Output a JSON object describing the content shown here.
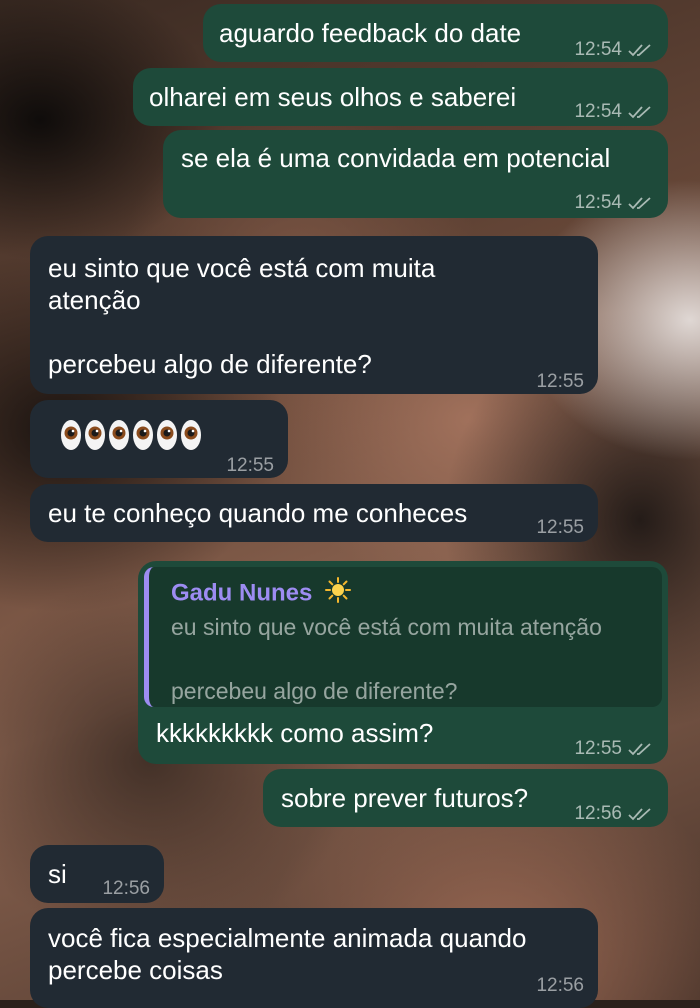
{
  "chat": {
    "messages": [
      {
        "direction": "out",
        "text": "aguardo feedback do date",
        "time": "12:54",
        "status": "read"
      },
      {
        "direction": "out",
        "text": "olharei em seus olhos e saberei",
        "time": "12:54",
        "status": "read"
      },
      {
        "direction": "out",
        "text": "se ela é uma convidada em potencial",
        "time": "12:54",
        "status": "read"
      },
      {
        "direction": "in",
        "text": "eu sinto que você está com muita\natenção\n\npercebeu algo de diferente?",
        "time": "12:55"
      },
      {
        "direction": "in",
        "emoji": "eyes",
        "emoji_count": 6,
        "time": "12:55"
      },
      {
        "direction": "in",
        "text": "eu te conheço quando me conheces",
        "time": "12:55"
      },
      {
        "direction": "out",
        "reply_to": {
          "author": "Gadu Nunes",
          "author_icon": "sun-icon",
          "text": "eu sinto que você está com muita atenção\n\npercebeu algo de diferente?"
        },
        "text": "kkkkkkkkk como assim?",
        "time": "12:55",
        "status": "read"
      },
      {
        "direction": "out",
        "text": "sobre prever futuros?",
        "time": "12:56",
        "status": "read"
      },
      {
        "direction": "in",
        "text": "si",
        "time": "12:56"
      },
      {
        "direction": "in",
        "text": "você fica especialmente animada quando\npercebe coisas",
        "time": "12:56"
      }
    ]
  },
  "colors": {
    "outgoing_bubble": "#1e4a3a",
    "incoming_bubble": "#212a33",
    "reply_accent": "#9d8cf2",
    "text": "#ffffff"
  },
  "icons": {
    "read_status": "double-check-icon",
    "eyes": "eyes-emoji-icon",
    "author_badge": "sun-icon"
  }
}
